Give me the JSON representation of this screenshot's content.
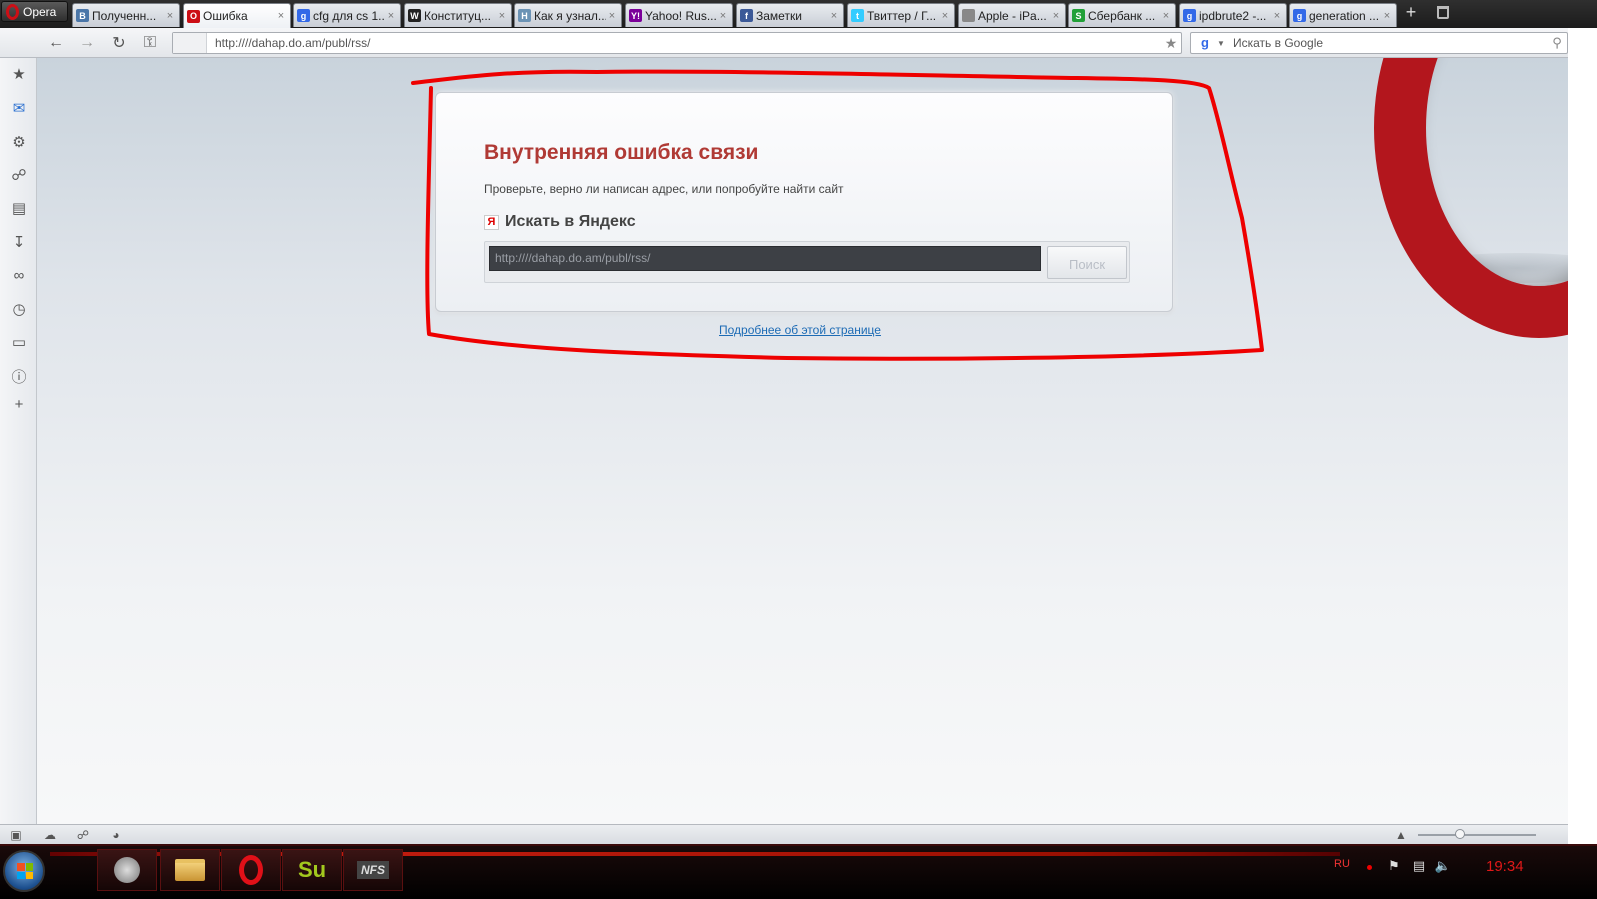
{
  "browser": {
    "menu_label": "Opera"
  },
  "tabs": [
    {
      "title": "Полученн...",
      "icon": "vk-icon",
      "favicon_text": "В",
      "favicon_color": "#4a76a8",
      "active": false
    },
    {
      "title": "Ошибка",
      "icon": "opera-icon",
      "favicon_text": "O",
      "favicon_color": "#cc0f16",
      "active": true
    },
    {
      "title": "cfg для cs 1...",
      "icon": "google-icon",
      "favicon_text": "g",
      "favicon_color": "#3369e8",
      "active": false
    },
    {
      "title": "Конституц...",
      "icon": "wikipedia-icon",
      "favicon_text": "W",
      "favicon_color": "#222222",
      "active": false
    },
    {
      "title": "Как я узнал...",
      "icon": "habr-icon",
      "favicon_text": "H",
      "favicon_color": "#6b93b5",
      "active": false
    },
    {
      "title": "Yahoo! Rus...",
      "icon": "yahoo-icon",
      "favicon_text": "Y!",
      "favicon_color": "#7b0099",
      "active": false
    },
    {
      "title": "Заметки",
      "icon": "facebook-icon",
      "favicon_text": "f",
      "favicon_color": "#3b5998",
      "active": false
    },
    {
      "title": "Твиттер / Г...",
      "icon": "twitter-icon",
      "favicon_text": "t",
      "favicon_color": "#33ccff",
      "active": false
    },
    {
      "title": "Apple - iPa...",
      "icon": "apple-icon",
      "favicon_text": "",
      "favicon_color": "#888888",
      "active": false
    },
    {
      "title": "Сбербанк ...",
      "icon": "sberbank-icon",
      "favicon_text": "S",
      "favicon_color": "#21a038",
      "active": false
    },
    {
      "title": "ipdbrute2 -...",
      "icon": "google-icon",
      "favicon_text": "g",
      "favicon_color": "#3369e8",
      "active": false
    },
    {
      "title": "generation ...",
      "icon": "google-icon",
      "favicon_text": "g",
      "favicon_color": "#3369e8",
      "active": false
    }
  ],
  "address_bar": {
    "url": "http:////dahap.do.am/publ/rss/"
  },
  "search_bar": {
    "placeholder": "Искать в Google"
  },
  "error_page": {
    "title": "Внутренняя ошибка связи",
    "description": "Проверьте, верно ли написан адрес, или попробуйте найти сайт",
    "yandex_logo": "Я",
    "search_label": "Искать в Яндекс",
    "search_value": "http:////dahap.do.am/publ/rss/",
    "search_button": "Поиск",
    "more_link": "Подробнее об этой странице"
  },
  "taskbar": {
    "language": "RU",
    "clock": "19:34",
    "pinned": [
      "speaker-icon",
      "folder-icon",
      "opera-icon",
      "sketchup-icon",
      "nfs-icon"
    ],
    "sketchup_label": "Su",
    "nfs_label": "NFS"
  },
  "colors": {
    "error_title": "#b03a35",
    "opera_red": "#cc0f16",
    "annotation_red": "#ee0000",
    "link_blue": "#1d6bb5"
  }
}
